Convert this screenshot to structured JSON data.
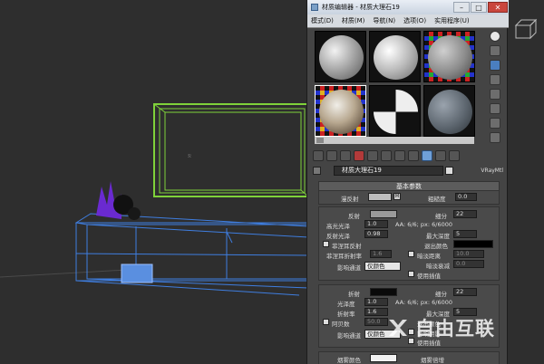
{
  "window": {
    "title": "材质编辑器 - 材质大理石19",
    "minimize": "–",
    "maximize": "□",
    "close": "✕"
  },
  "menu": [
    "模式(D)",
    "材质(M)",
    "导航(N)",
    "选项(O)",
    "实用程序(U)"
  ],
  "material": {
    "name": "材质大理石19",
    "type": "VRayMtl"
  },
  "basic_params": {
    "header": "基本参数",
    "diffuse_label": "漫反射",
    "diffuse_map": "M",
    "roughness_label": "粗糙度",
    "roughness_value": "0.0"
  },
  "reflection": {
    "label": "反射",
    "subdiv_label": "细分",
    "subdiv_value": "22",
    "gloss_label": "高光光泽",
    "gloss_value": "1.0",
    "aa_info": "AA: 6/6; px: 6/6000",
    "refl_gloss_label": "反射光泽",
    "refl_gloss_value": "0.98",
    "max_depth_label": "最大深度",
    "max_depth_value": "5",
    "fresnel_label": "菲涅耳反射",
    "exit_color_label": "退出颜色",
    "fresnel_ior_label": "菲涅耳折射率",
    "fresnel_ior_value": "1.6",
    "dim_dist_label": "暗淡距离",
    "dim_dist_value": "10.0",
    "dim_falloff_label": "暗淡衰减",
    "dim_falloff_value": "0.0",
    "affect_channels_label": "影响通道",
    "affect_channels_value": "仅颜色",
    "use_interp_label": "使用插值"
  },
  "refraction": {
    "label": "折射",
    "subdiv_label": "细分",
    "subdiv_value": "22",
    "gloss_label": "光泽度",
    "gloss_value": "1.0",
    "aa_info": "AA: 6/6; px: 6/6000",
    "ior_label": "折射率",
    "ior_value": "1.6",
    "max_depth_label": "最大深度",
    "max_depth_value": "5",
    "abbe_label": "阿贝数",
    "abbe_value": "50.0",
    "exit_color_label": "退出颜色",
    "affect_channels_label": "影响通道",
    "affect_channels_value": "仅颜色",
    "affect_shadows_label": "影响阴影",
    "use_interp_label": "使用插值"
  },
  "fog": {
    "color_label": "烟雾颜色",
    "mult_label": "烟雾倍增"
  },
  "watermark": "自由互联",
  "colors": {
    "selection": "#78c03c",
    "cabinet": "#3f7ee0",
    "panel": "#444444"
  }
}
